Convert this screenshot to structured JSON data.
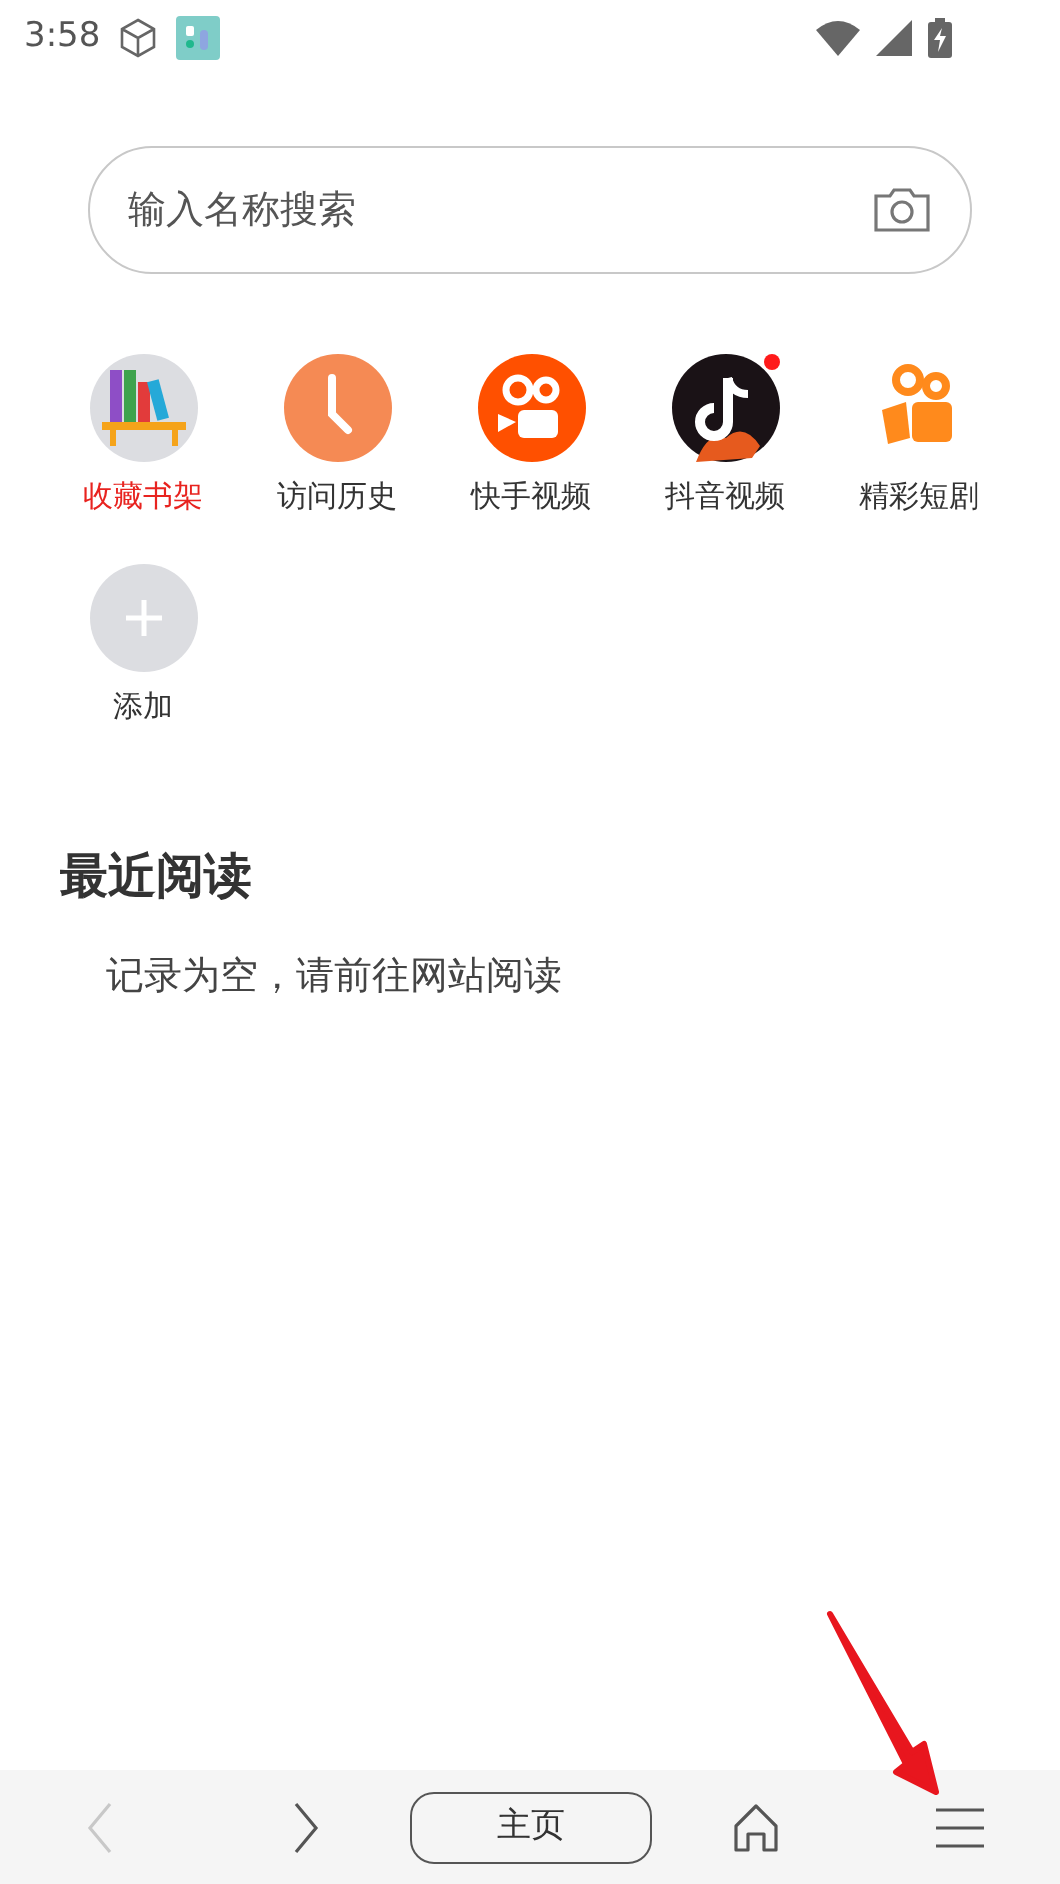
{
  "status_bar": {
    "time": "3:58"
  },
  "search": {
    "placeholder": "输入名称搜索"
  },
  "shortcuts": [
    {
      "kind": "books",
      "label": "收藏书架",
      "selected": true,
      "dot": false
    },
    {
      "kind": "clock",
      "label": "访问历史",
      "selected": false,
      "dot": false
    },
    {
      "kind": "camera",
      "label": "快手视频",
      "selected": false,
      "dot": false
    },
    {
      "kind": "note",
      "label": "抖音视频",
      "selected": false,
      "dot": true
    },
    {
      "kind": "film",
      "label": "精彩短剧",
      "selected": false,
      "dot": false
    },
    {
      "kind": "add",
      "label": "添加",
      "selected": false,
      "dot": false
    }
  ],
  "recent": {
    "title": "最近阅读",
    "empty_text": "记录为空，请前往网站阅读"
  },
  "bottom_bar": {
    "back_disabled": true,
    "forward_disabled": false,
    "home_label": "主页"
  }
}
